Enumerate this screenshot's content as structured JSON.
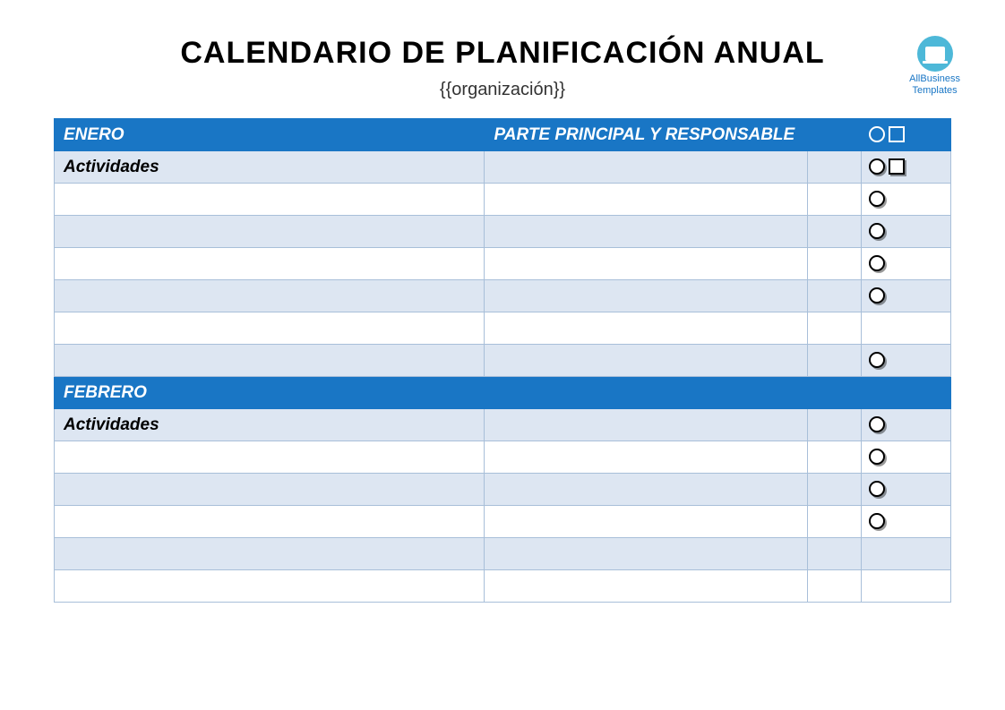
{
  "header": {
    "title": "CALENDARIO DE PLANIFICACIÓN ANUAL",
    "subtitle": "{{organización}}",
    "logo_line1": "AllBusiness",
    "logo_line2": "Templates"
  },
  "months": [
    {
      "name": "ENERO",
      "responsible_header": "PARTE PRINCIPAL Y RESPONSABLE",
      "section_label": "Actividades",
      "header_has_icons": true,
      "section_has_icons": true,
      "rows": [
        {
          "has_circle": true,
          "alt": "odd"
        },
        {
          "has_circle": true,
          "alt": "even"
        },
        {
          "has_circle": true,
          "alt": "odd"
        },
        {
          "has_circle": true,
          "alt": "even"
        },
        {
          "has_circle": false,
          "alt": "odd"
        },
        {
          "has_circle": true,
          "alt": "even"
        }
      ]
    },
    {
      "name": "FEBRERO",
      "responsible_header": "",
      "section_label": "Actividades",
      "header_has_icons": false,
      "section_has_icons": false,
      "section_has_circle": true,
      "rows": [
        {
          "has_circle": true,
          "alt": "odd"
        },
        {
          "has_circle": true,
          "alt": "even"
        },
        {
          "has_circle": true,
          "alt": "odd"
        },
        {
          "has_circle": false,
          "alt": "even"
        },
        {
          "has_circle": false,
          "alt": "odd"
        }
      ]
    }
  ]
}
